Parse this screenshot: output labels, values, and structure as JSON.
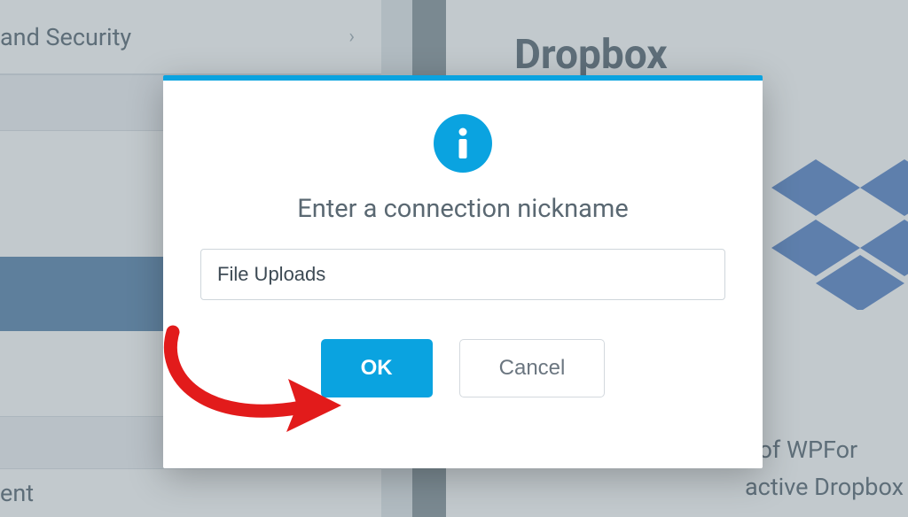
{
  "sidebar": {
    "items": [
      {
        "label": "and Security"
      }
    ],
    "last_item_label": "ent"
  },
  "right": {
    "title": "Dropbox",
    "desc_line1": "t of WPFor",
    "desc_line2": "active Dropbox"
  },
  "modal": {
    "heading": "Enter a connection nickname",
    "input_value": "File Uploads",
    "ok_label": "OK",
    "cancel_label": "Cancel"
  },
  "colors": {
    "accent": "#0aa3e0",
    "text": "#4a5a66"
  }
}
